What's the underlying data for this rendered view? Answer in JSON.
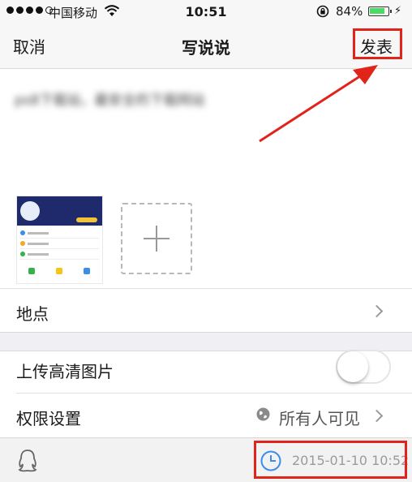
{
  "status_bar": {
    "carrier": "中国移动",
    "time": "10:51",
    "battery_pct": "84%",
    "battery_level": 0.84,
    "icons": [
      "signal-dots",
      "wifi-icon",
      "rotation-lock-icon",
      "battery-icon",
      "charging-bolt-icon"
    ]
  },
  "nav": {
    "cancel_label": "取消",
    "title": "写说说",
    "publish_label": "发表"
  },
  "compose": {
    "text": "ps8下载站，最安全的下载网站",
    "add_photo_icon": "plus-icon"
  },
  "rows": {
    "location_label": "地点",
    "hd_upload_label": "上传高清图片",
    "hd_upload_on": false,
    "permission_label": "权限设置",
    "permission_value": "所有人可见"
  },
  "toolbar": {
    "datetime": "2015-01-10 10:52",
    "icons": [
      "qq-penguin-icon",
      "clock-icon"
    ]
  },
  "colors": {
    "highlight": "#e2231a",
    "background": "#efeff4",
    "battery": "#4cd964"
  }
}
